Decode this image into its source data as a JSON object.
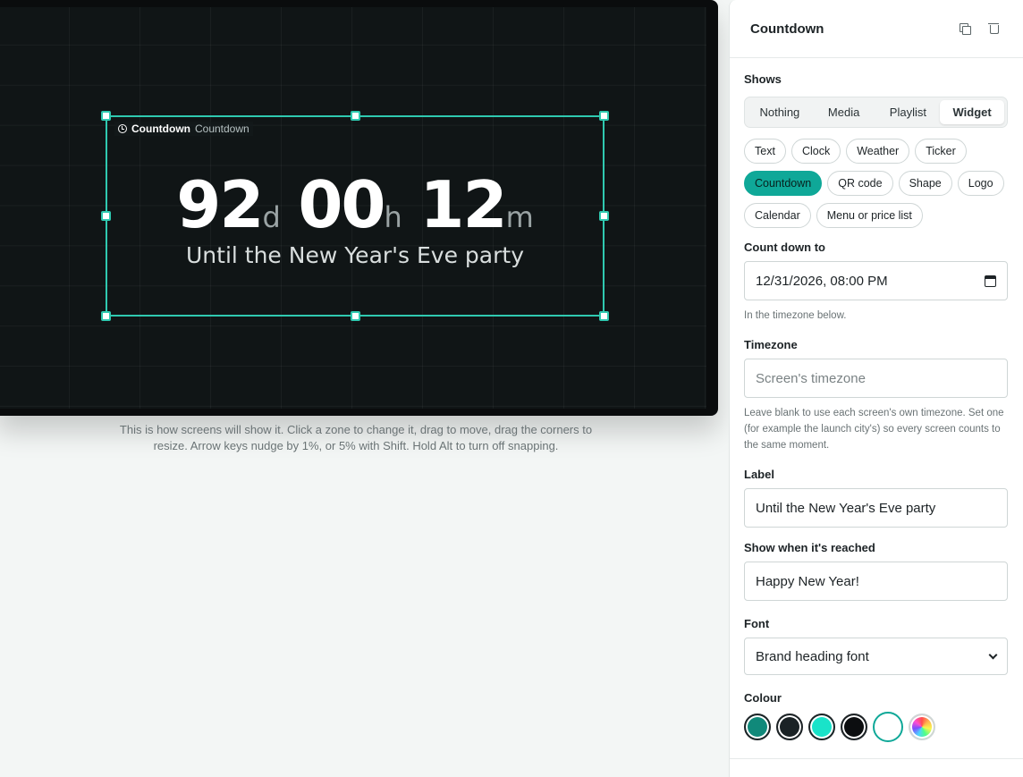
{
  "canvas": {
    "zone_tag_title": "Countdown",
    "zone_tag_kind": "Countdown",
    "countdown": {
      "days": "92",
      "days_unit": "d",
      "hours": "00",
      "hours_unit": "h",
      "minutes": "12",
      "minutes_unit": "m"
    },
    "label": "Until the New Year's Eve party",
    "help": "This is how screens will show it. Click a zone to change it, drag to move, drag the corners to resize. Arrow keys nudge by 1%, or 5% with Shift. Hold Alt to turn off snapping."
  },
  "panel": {
    "title": "Countdown",
    "shows_label": "Shows",
    "shows_options": [
      "Nothing",
      "Media",
      "Playlist",
      "Widget"
    ],
    "shows_selected": "Widget",
    "widgets": [
      "Text",
      "Clock",
      "Weather",
      "Ticker",
      "Countdown",
      "QR code",
      "Shape",
      "Logo",
      "Calendar",
      "Menu or price list"
    ],
    "widget_selected": "Countdown",
    "count_down_to": {
      "label": "Count down to",
      "value": "12/31/2026, 08:00 PM",
      "hint": "In the timezone below."
    },
    "timezone": {
      "label": "Timezone",
      "placeholder": "Screen's timezone",
      "hint": "Leave blank to use each screen's own timezone. Set one (for example the launch city's) so every screen counts to the same moment."
    },
    "label_field": {
      "label": "Label",
      "value": "Until the New Year's Eve party"
    },
    "reached_field": {
      "label": "Show when it's reached",
      "value": "Happy New Year!"
    },
    "font_field": {
      "label": "Font",
      "value": "Brand heading font"
    },
    "colour": {
      "label": "Colour",
      "swatches": [
        "#10897a",
        "#1a2225",
        "#19e3c9",
        "#0c0e10",
        "#ffffff",
        "custom"
      ],
      "selected": "#ffffff"
    }
  }
}
